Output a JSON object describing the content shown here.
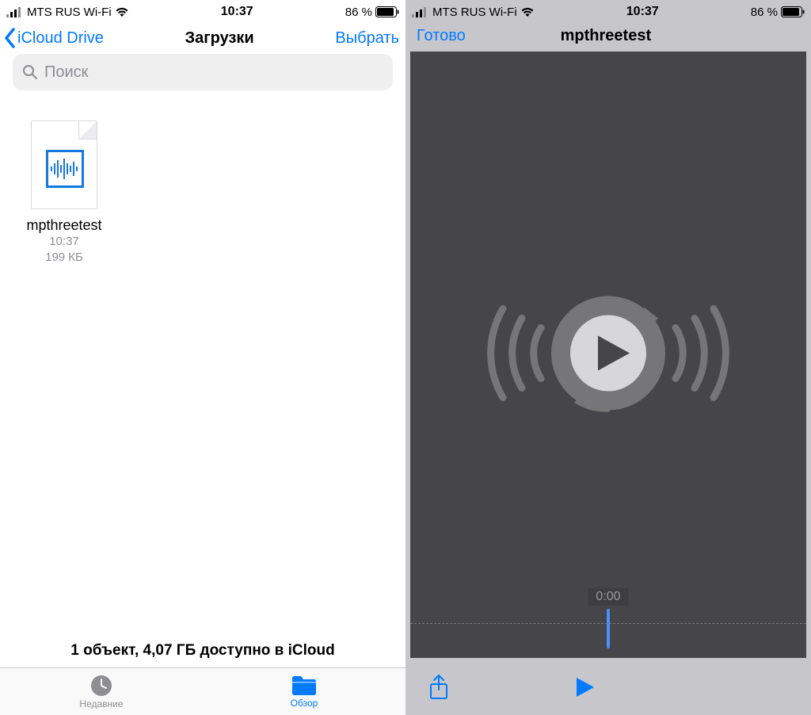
{
  "status": {
    "carrier": "MTS RUS Wi-Fi",
    "time": "10:37",
    "battery_percent": "86 %"
  },
  "files_pane": {
    "back_label": "iCloud Drive",
    "title": "Загрузки",
    "select_label": "Выбрать",
    "search_placeholder": "Поиск",
    "item": {
      "name": "mpthreetest",
      "time": "10:37",
      "size": "199 КБ"
    },
    "summary": "1 объект, 4,07 ГБ доступно в iCloud",
    "tabs": {
      "recent": "Недавние",
      "browse": "Обзор"
    }
  },
  "player_pane": {
    "done_label": "Готово",
    "title": "mpthreetest",
    "playback_time": "0:00"
  }
}
